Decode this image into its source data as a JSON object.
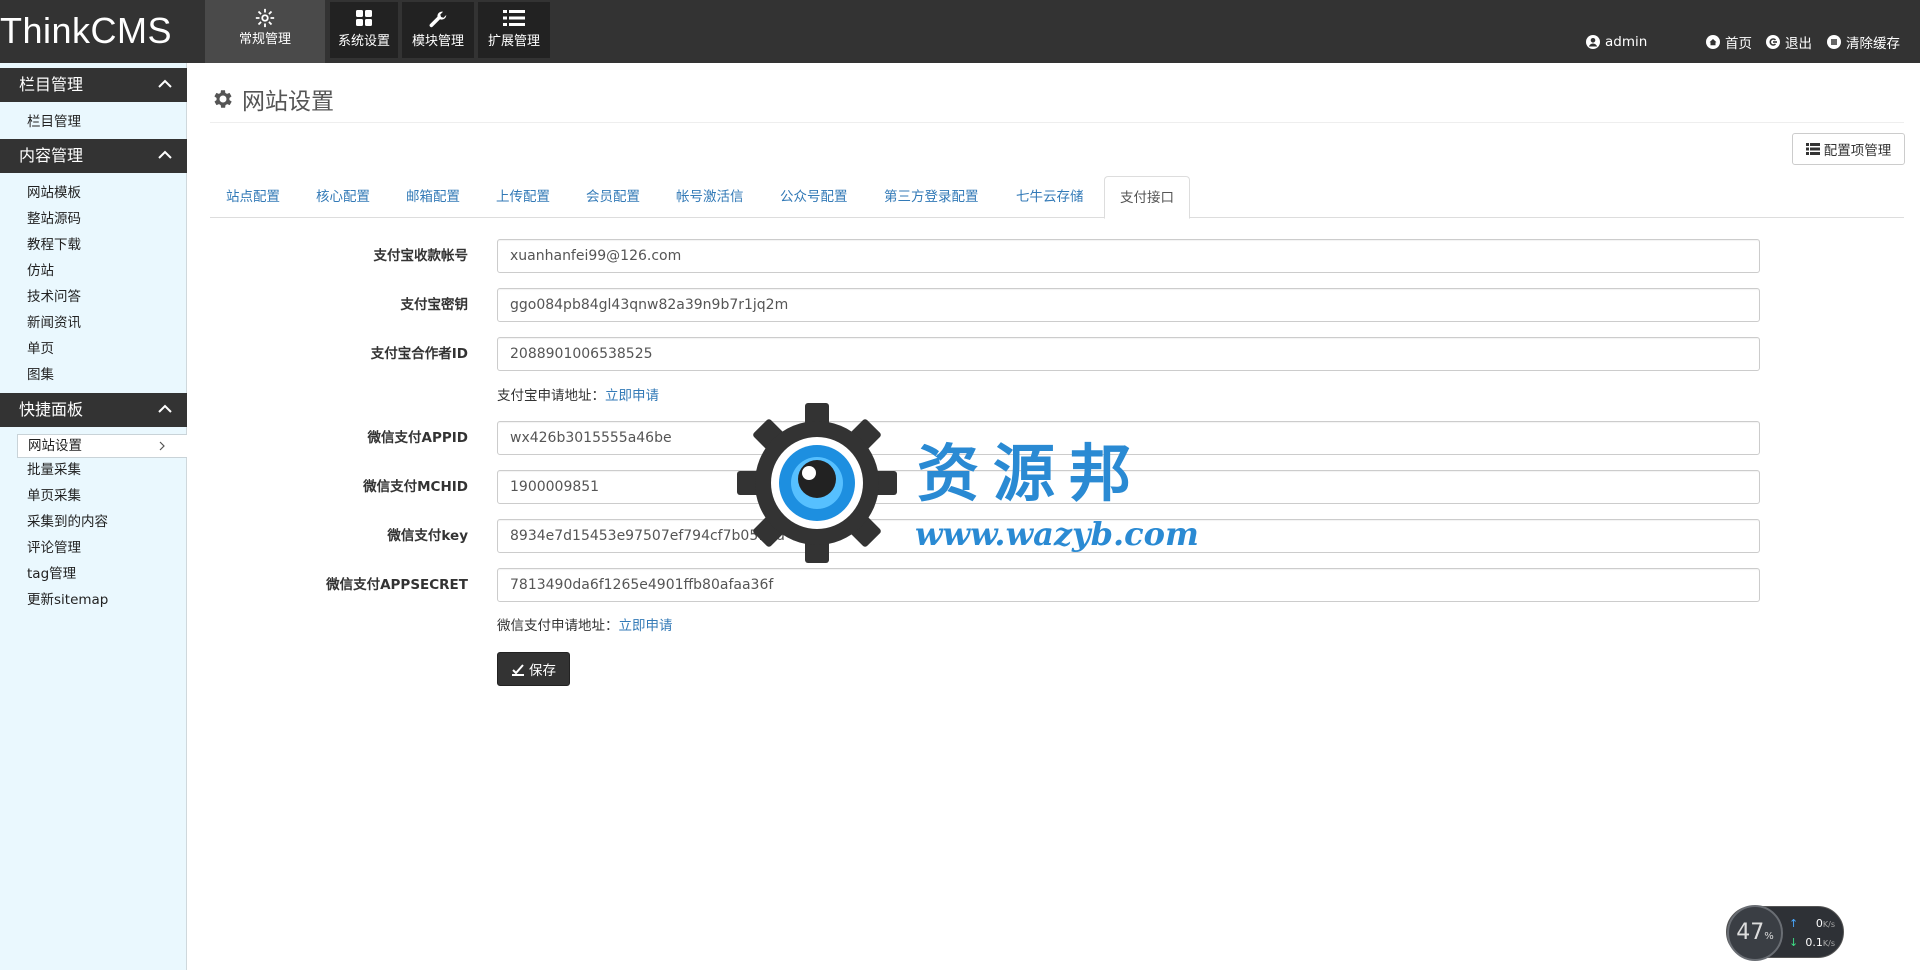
{
  "brand": "ThinkCMS",
  "top_modules": [
    {
      "label": "常规管理",
      "icon": "cog-icon"
    },
    {
      "label": "系统设置",
      "icon": "grid-icon"
    },
    {
      "label": "模块管理",
      "icon": "wrench-icon"
    },
    {
      "label": "扩展管理",
      "icon": "list-icon"
    }
  ],
  "user": {
    "name": "admin",
    "icon": "user-icon"
  },
  "top_right": [
    {
      "label": "首页",
      "icon": "home-icon"
    },
    {
      "label": "退出",
      "icon": "logout-icon"
    },
    {
      "label": "清除缓存",
      "icon": "clear-cache-icon"
    }
  ],
  "sidebar": {
    "sections": [
      {
        "title": "栏目管理",
        "items": [
          "栏目管理"
        ]
      },
      {
        "title": "内容管理",
        "items": [
          "网站模板",
          "整站源码",
          "教程下载",
          "仿站",
          "技术问答",
          "新闻资讯",
          "单页",
          "图集"
        ]
      },
      {
        "title": "快捷面板",
        "items": [
          "网站设置",
          "批量采集",
          "单页采集",
          "采集到的内容",
          "评论管理",
          "tag管理",
          "更新sitemap"
        ]
      }
    ]
  },
  "page": {
    "title": "网站设置",
    "config_button": "配置项管理"
  },
  "tabs": [
    "站点配置",
    "核心配置",
    "邮箱配置",
    "上传配置",
    "会员配置",
    "帐号激活信",
    "公众号配置",
    "第三方登录配置",
    "七牛云存储",
    "支付接口"
  ],
  "active_tab": "支付接口",
  "form": {
    "fields": [
      {
        "label": "支付宝收款帐号",
        "value": "xuanhanfei99@126.com"
      },
      {
        "label": "支付宝密钥",
        "value": "ggo084pb84gl43qnw82a39n9b7r1jq2m"
      },
      {
        "label": "支付宝合作者ID",
        "value": "2088901006538525"
      },
      {
        "label": "微信支付APPID",
        "value": "wx426b3015555a46be"
      },
      {
        "label": "微信支付MCHID",
        "value": "1900009851"
      },
      {
        "label": "微信支付key",
        "value": "8934e7d15453e97507ef794cf7b0519d"
      },
      {
        "label": "微信支付APPSECRET",
        "value": "7813490da6f1265e4901ffb80afaa36f"
      }
    ],
    "alipay_help": {
      "text": "支付宝申请地址：",
      "link": "立即申请"
    },
    "wechat_help": {
      "text": "微信支付申请地址：",
      "link": "立即申请"
    },
    "save_label": "保存"
  },
  "watermark": {
    "title": "资源邦",
    "url": "www.wazyb.com"
  },
  "speed_widget": {
    "percent": "47",
    "percent_unit": "%",
    "up": "0",
    "down": "0.1",
    "unit": "K/s"
  },
  "colors": {
    "topbar": "#333333",
    "sidebar_bg": "#eaf8fe",
    "link": "#337ab7",
    "watermark": "#2a8ad3"
  }
}
